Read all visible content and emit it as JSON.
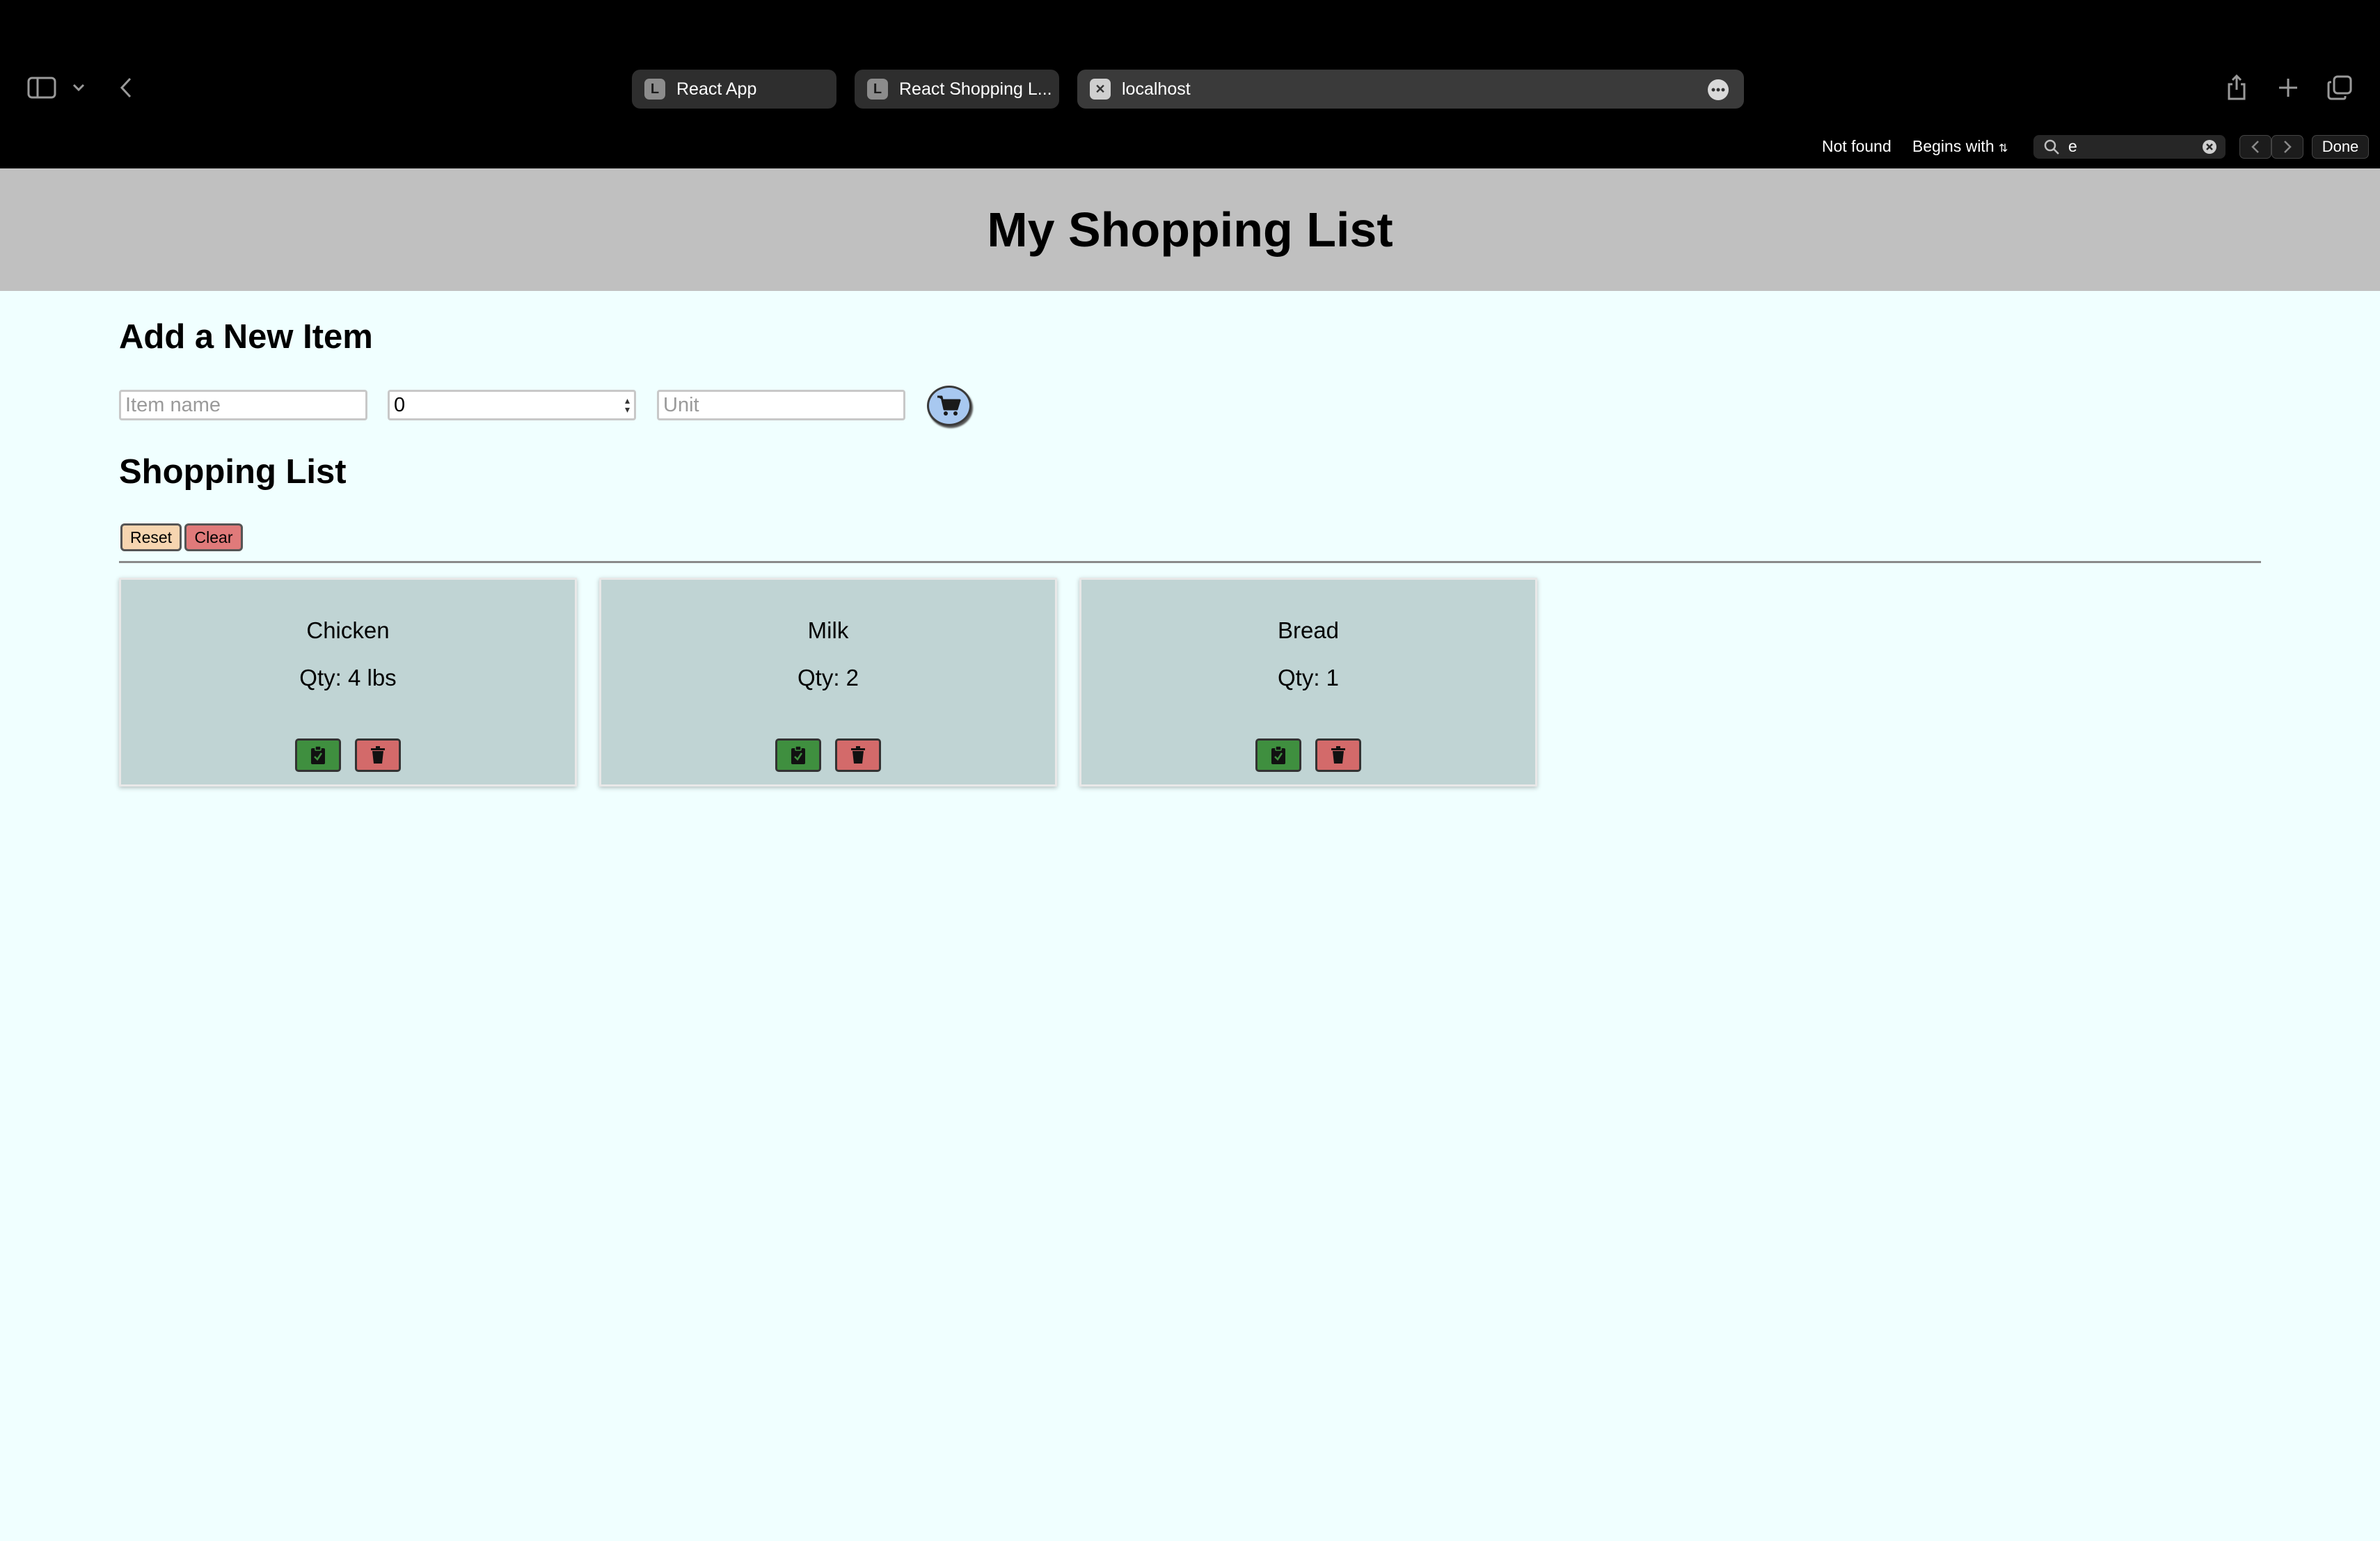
{
  "browser": {
    "tabs": [
      {
        "favicon": "L",
        "title": "React App",
        "active": false
      },
      {
        "favicon": "L",
        "title": "React Shopping L...",
        "active": false
      },
      {
        "favicon": "✕",
        "title": "localhost",
        "active": true
      }
    ],
    "find_bar": {
      "status": "Not found",
      "mode": "Begins with",
      "query": "e",
      "done_label": "Done"
    }
  },
  "page": {
    "title": "My Shopping List",
    "add_section_title": "Add a New Item",
    "item_name_placeholder": "Item name",
    "quantity_value": "0",
    "unit_placeholder": "Unit",
    "list_section_title": "Shopping List",
    "reset_label": "Reset",
    "clear_label": "Clear",
    "items": [
      {
        "name": "Chicken",
        "qty": "Qty: 4 lbs"
      },
      {
        "name": "Milk",
        "qty": "Qty: 2"
      },
      {
        "name": "Bread",
        "qty": "Qty: 1"
      }
    ]
  },
  "colors": {
    "page_bg": "#f0ffff",
    "header_bg": "#c0c0c0",
    "card_bg": "#c0d4d4",
    "done_button": "#3f8f3f",
    "delete_button": "#d36a6a",
    "reset_button": "#f6d5b0",
    "clear_button": "#e07a7a",
    "cart_button": "#a8c8f0"
  },
  "icons": {
    "sidebar": "sidebar-icon",
    "back": "chevron-left-icon",
    "share": "share-icon",
    "new_tab": "plus-icon",
    "tab_overview": "tabs-icon",
    "cart": "cart-icon",
    "done_item": "clipboard-check-icon",
    "delete_item": "trash-icon"
  }
}
